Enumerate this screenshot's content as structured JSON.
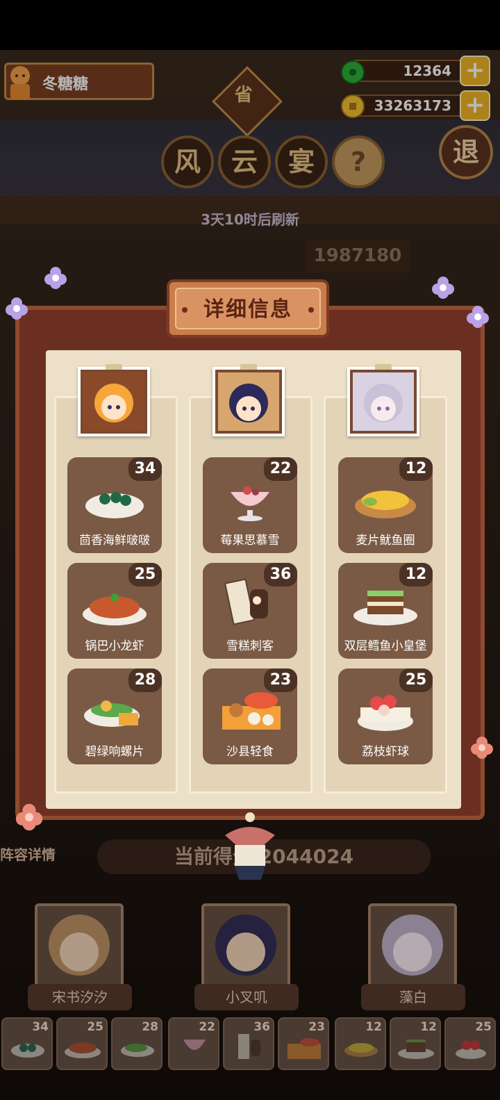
{
  "player": {
    "name": "冬糖糖"
  },
  "currency": {
    "jade": "12364",
    "coins": "33263173"
  },
  "event": {
    "badge_top": "省",
    "title_chars": [
      "风",
      "云",
      "宴"
    ],
    "help": "?",
    "exit": "退",
    "refresh": "3天10时后刷新",
    "top_score": "1987180"
  },
  "panel": {
    "title": "详细信息",
    "columns": [
      {
        "dishes": [
          {
            "name": "茴香海鲜啵啵",
            "count": "34"
          },
          {
            "name": "锅巴小龙虾",
            "count": "25"
          },
          {
            "name": "碧绿响螺片",
            "count": "28"
          }
        ]
      },
      {
        "dishes": [
          {
            "name": "莓果思慕雪",
            "count": "22"
          },
          {
            "name": "雪糕刺客",
            "count": "36"
          },
          {
            "name": "沙县轻食",
            "count": "23"
          }
        ]
      },
      {
        "dishes": [
          {
            "name": "麦片鱿鱼圈",
            "count": "12"
          },
          {
            "name": "双层鳕鱼小皇堡",
            "count": "12"
          },
          {
            "name": "荔枝虾球",
            "count": "25"
          }
        ]
      }
    ]
  },
  "bottom": {
    "lineup_label": "阵容详情",
    "score_label": "当前得分 2044024",
    "heroes": [
      "宋书汐汐",
      "小叉叽",
      "藻白"
    ],
    "slots": [
      "34",
      "25",
      "28",
      "22",
      "36",
      "23",
      "12",
      "12",
      "25"
    ]
  }
}
